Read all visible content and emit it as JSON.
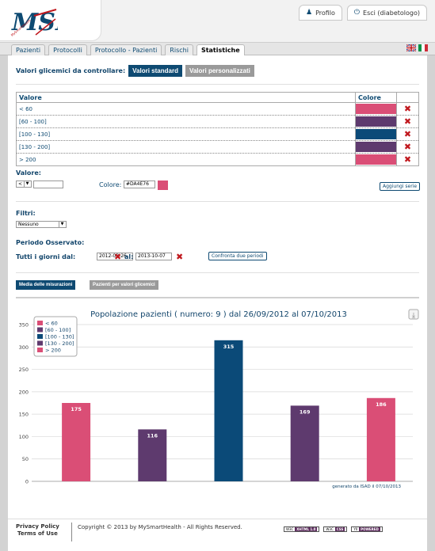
{
  "header": {
    "logo_text": "MSH",
    "logo_small": "MySmartHealth",
    "profile_label": "Profilo",
    "logout_label": "Esci (diabetologo)"
  },
  "nav": {
    "tabs": [
      {
        "label": "Pazienti"
      },
      {
        "label": "Protocolli"
      },
      {
        "label": "Protocollo - Pazienti"
      },
      {
        "label": "Rischi"
      },
      {
        "label": "Statistiche"
      }
    ],
    "active_tab": "Statistiche"
  },
  "glycemic": {
    "label": "Valori glicemici da controllare:",
    "standard_button": "Valori standard",
    "custom_button": "Valori personalizzati"
  },
  "values_table": {
    "headers": {
      "value": "Valore",
      "color": "Colore"
    },
    "rows": [
      {
        "value": "< 60",
        "color": "#da4e76"
      },
      {
        "value": "[60 - 100]",
        "color": "#5e3a6e"
      },
      {
        "value": "[100 - 130]",
        "color": "#0b4a78"
      },
      {
        "value": "[130 - 200]",
        "color": "#5e3a6e"
      },
      {
        "value": "> 200",
        "color": "#da4e76"
      }
    ]
  },
  "value_form": {
    "label": "Valore:",
    "operator": "<",
    "color_label": "Colore:",
    "color_value": "#DA4E76",
    "add_button": "Aggiungi serie"
  },
  "filters": {
    "label": "Filtri:",
    "selected": "Nessuno"
  },
  "period": {
    "label": "Periodo Osservato:",
    "all_days_label": "Tutti i giorni dal:",
    "from": "2012-09-26",
    "to_label": "al:",
    "to": "2013-10-07",
    "compare_button": "Confronta due periodi"
  },
  "view_buttons": {
    "averages": "Media delle misurazioni",
    "patients": "Pazienti per valori glicemici"
  },
  "chart_data": {
    "type": "bar",
    "title": "Popolazione pazienti ( numero: 9 ) dal 26/09/2012 al 07/10/2013",
    "categories": [
      "< 60",
      "[60 - 100]",
      "[100 - 130]",
      "[130 - 200]",
      "> 200"
    ],
    "values": [
      175,
      116,
      315,
      169,
      186
    ],
    "colors": [
      "#da4e76",
      "#5e3a6e",
      "#0b4a78",
      "#5e3a6e",
      "#da4e76"
    ],
    "ylim": [
      0,
      350
    ],
    "yticks": [
      0,
      50,
      100,
      150,
      200,
      250,
      300,
      350
    ],
    "legend_position": "top-left",
    "grid": true,
    "credit": "generato da ISAD il 07/10/2013"
  },
  "footer": {
    "privacy": "Privacy Policy",
    "terms": "Terms of Use",
    "copyright": "Copyright © 2013 by MySmartHealth - All Rights Reserved.",
    "badges": [
      {
        "left": "W3C",
        "right": "XHTML 1.0"
      },
      {
        "left": "W3C",
        "right": "CSS"
      },
      {
        "left": "YII",
        "right": "POWERED"
      }
    ]
  }
}
